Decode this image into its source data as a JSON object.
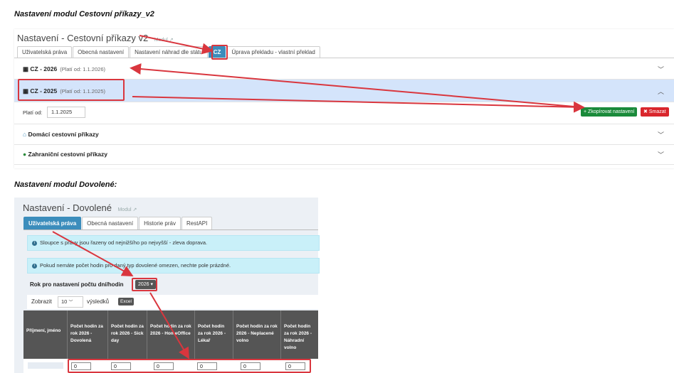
{
  "heading1": "Nastavení modul Cestovní příkazy_v2",
  "heading2": "Nastavení modul Dovolené:",
  "panel1": {
    "title": "Nastavení - Cestovní příkazy v2",
    "modul_link": "Modul",
    "tabs": [
      "Uživatelská práva",
      "Obecná nastavení",
      "Nastavení náhrad dle státu",
      "CZ",
      "Úprava překladu - vlastní překlad"
    ],
    "rows": [
      {
        "label": "CZ - 2026",
        "valid": "(Platí od: 1.1.2026)",
        "icon": "calendar-icon"
      },
      {
        "label": "CZ - 2025",
        "valid": "(Platí od: 1.1.2025)",
        "icon": "calendar-icon"
      }
    ],
    "valid_from_label": "Platí od:",
    "valid_from_value": "1.1.2025",
    "copy_button": "Zkopírovat nastavení",
    "delete_button": "Smazat",
    "domestic_label": "Domácí cestovní příkazy",
    "foreign_label": "Zahraniční cestovní příkazy"
  },
  "panel2": {
    "title": "Nastavení - Dovolené",
    "modul_link": "Modul",
    "tabs": [
      "Uživatelská práva",
      "Obecná nastavení",
      "Historie práv",
      "RestAPI"
    ],
    "info1": "Sloupce s právy jsou řazeny od nejnižšího po nejvyšší - zleva doprava.",
    "info2": "Pokud nemáte počet hodin pro daný typ dovolené omezen, nechte pole prázdné.",
    "year_label": "Rok pro nastavení počtu dní/hodin",
    "year_value": "2026",
    "show_label": "Zobrazit",
    "show_value": "10",
    "results_label": "výsledků",
    "excel_label": "Excel",
    "columns": [
      "Příjmení, jméno",
      "Počet hodin za rok 2026 - Dovolená",
      "Počet hodin za rok 2026 - Sick day",
      "Počet hodin za rok 2026 - HomeOffice",
      "Počet hodin za rok 2026 - Lékař",
      "Počet hodin za rok 2026 - Neplacené volno",
      "Počet hodin za rok 2026 - Náhradní volno"
    ],
    "row_values": [
      "0",
      "0",
      "0",
      "0",
      "0",
      "0"
    ]
  },
  "colors": {
    "accent": "#3c8dbc",
    "annotation": "#d9363e",
    "success": "#1a8a3a",
    "danger": "#d9262c",
    "highlight": "#d4e4fb"
  }
}
